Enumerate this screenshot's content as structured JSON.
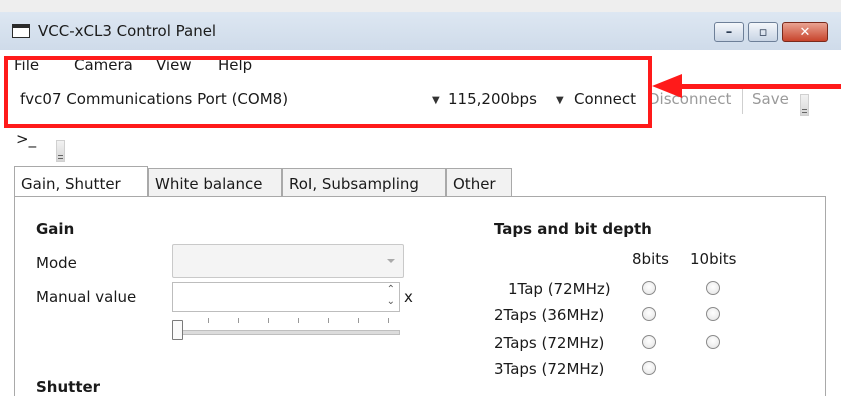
{
  "window": {
    "title": "VCC-xCL3 Control Panel",
    "controls": {
      "minimize": "–",
      "maximize": "▫",
      "close": "✕"
    }
  },
  "menu": [
    "File",
    "Camera",
    "View",
    "Help"
  ],
  "connection": {
    "port": "fvc07 Communications Port (COM8)",
    "baud": "115,200bps",
    "connect_label": "Connect",
    "disconnect_label": "Disconnect",
    "save_label": "Save"
  },
  "console": {
    "prompt": ">_"
  },
  "tabs": [
    "Gain, Shutter",
    "White balance",
    "RoI, Subsampling",
    "Other"
  ],
  "gain": {
    "heading": "Gain",
    "mode_label": "Mode",
    "mode_value": "",
    "manual_label": "Manual value",
    "manual_value": "",
    "unit": "x"
  },
  "taps": {
    "heading": "Taps and bit depth",
    "col_8": "8bits",
    "col_10": "10bits",
    "rows": [
      "1Tap (72MHz)",
      "2Taps (36MHz)",
      "2Taps (72MHz)",
      "3Taps (72MHz)"
    ]
  },
  "shutter": {
    "heading": "Shutter"
  },
  "colors": {
    "highlight": "#ff1a1a"
  }
}
